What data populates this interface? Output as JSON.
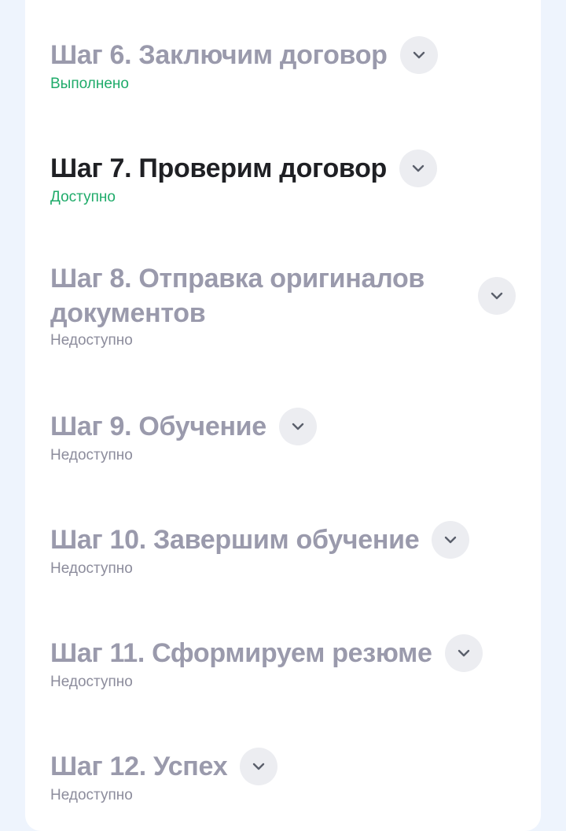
{
  "steps": [
    {
      "title": "Шаг 6. Заключим договор",
      "status": "Выполнено"
    },
    {
      "title": "Шаг 7. Проверим договор",
      "status": "Доступно"
    },
    {
      "title": "Шаг 8. Отправка оригиналов документов",
      "status": "Недоступно"
    },
    {
      "title": "Шаг 9. Обучение",
      "status": "Недоступно"
    },
    {
      "title": "Шаг 10. Завершим обучение",
      "status": "Недоступно"
    },
    {
      "title": "Шаг 11. Сформируем резюме",
      "status": "Недоступно"
    },
    {
      "title": "Шаг 12. Успех",
      "status": "Недоступно"
    }
  ],
  "icons": {
    "expand": "chevron-down-icon"
  },
  "colors": {
    "background": "#eef4fd",
    "card": "#ffffff",
    "title_inactive": "#9a9aac",
    "title_active": "#1f2024",
    "status_done": "#1fab6a",
    "status_unavailable": "#8c8c9c",
    "chevron_bg": "#ecedf1"
  }
}
